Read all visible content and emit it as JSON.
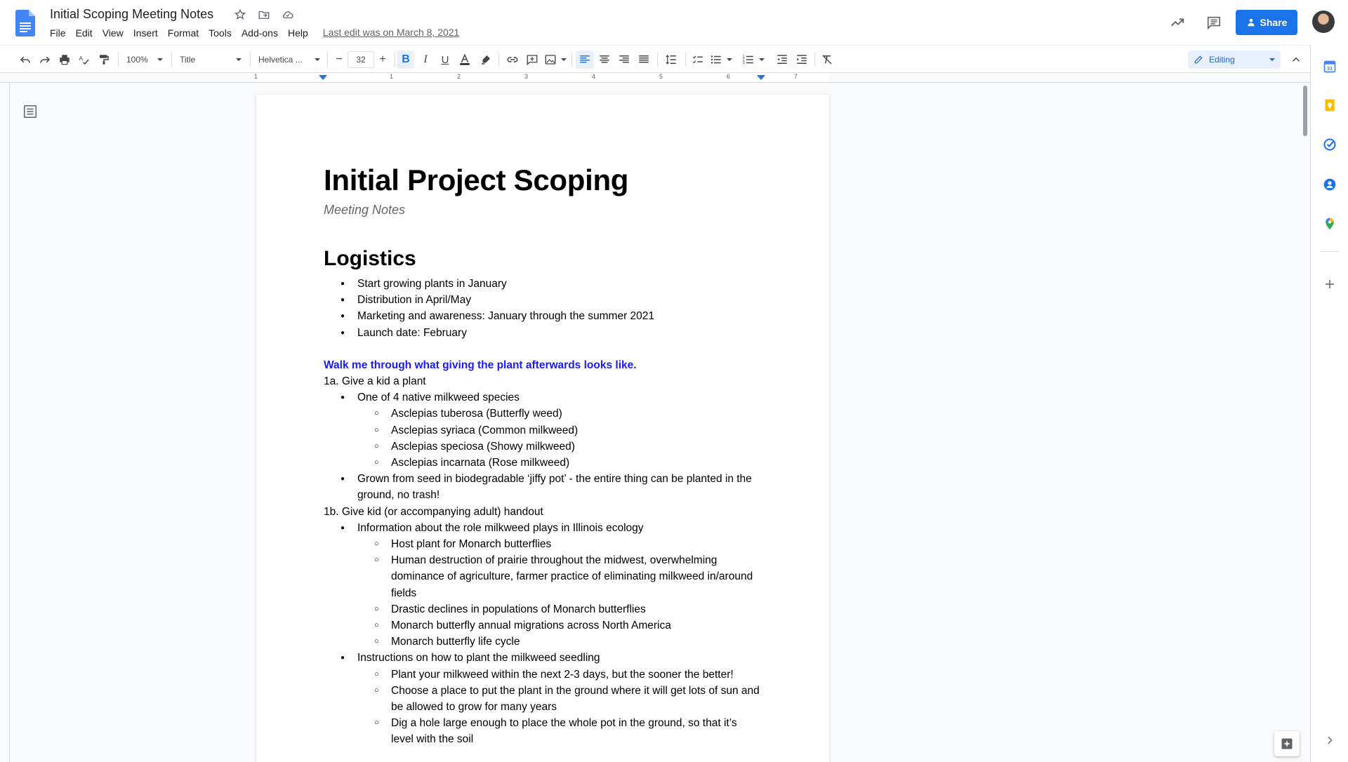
{
  "app": {
    "doc_title": "Initial Scoping Meeting Notes",
    "menu": [
      "File",
      "Edit",
      "View",
      "Insert",
      "Format",
      "Tools",
      "Add-ons",
      "Help"
    ],
    "last_edit": "Last edit was on March 8, 2021",
    "share_label": "Share"
  },
  "toolbar": {
    "zoom": "100%",
    "style": "Title",
    "font": "Helvetica ...",
    "font_size": "32",
    "mode": "Editing"
  },
  "ruler": {
    "numbers": [
      "1",
      "1",
      "2",
      "3",
      "4",
      "5",
      "6",
      "7"
    ]
  },
  "document": {
    "title": "Initial Project Scoping",
    "subtitle": "Meeting Notes",
    "section1": {
      "heading": "Logistics",
      "items": [
        "Start growing plants in January",
        "Distribution in April/May",
        "Marketing and awareness: January through the summer 2021",
        "Launch date: February"
      ]
    },
    "walkthrough": {
      "heading": "Walk me through what giving the plant afterwards looks like.",
      "step1a": {
        "label": "1a. Give a kid a plant",
        "bullet1": "One of 4 native milkweed species",
        "species": [
          "Asclepias tuberosa (Butterfly weed)",
          "Asclepias syriaca (Common milkweed)",
          "Asclepias speciosa (Showy milkweed)",
          "Asclepias incarnata (Rose milkweed)"
        ],
        "bullet2": "Grown from seed in biodegradable ‘jiffy pot’ - the entire thing can be planted in the ground, no trash!"
      },
      "step1b": {
        "label": "1b. Give kid (or accompanying adult) handout",
        "bullet1": "Information about the role milkweed plays in Illinois ecology",
        "info": [
          "Host plant for Monarch butterflies",
          "Human destruction of prairie throughout the midwest, overwhelming dominance of agriculture, farmer practice of eliminating milkweed in/around fields",
          "Drastic declines in populations of Monarch butterflies",
          "Monarch butterfly annual migrations across North America",
          "Monarch butterfly life cycle"
        ],
        "bullet2": "Instructions on how to plant the milkweed seedling",
        "instructions": [
          "Plant your milkweed within the next 2-3 days, but the sooner the better!",
          "Choose a place to put the plant in the ground where it will get lots of sun and be allowed to grow for many years",
          "Dig a hole large enough to place the whole pot in the ground, so that it’s level with the soil"
        ]
      }
    }
  },
  "colors": {
    "accent": "#1a73e8",
    "heading_blue": "#1a1aff"
  }
}
